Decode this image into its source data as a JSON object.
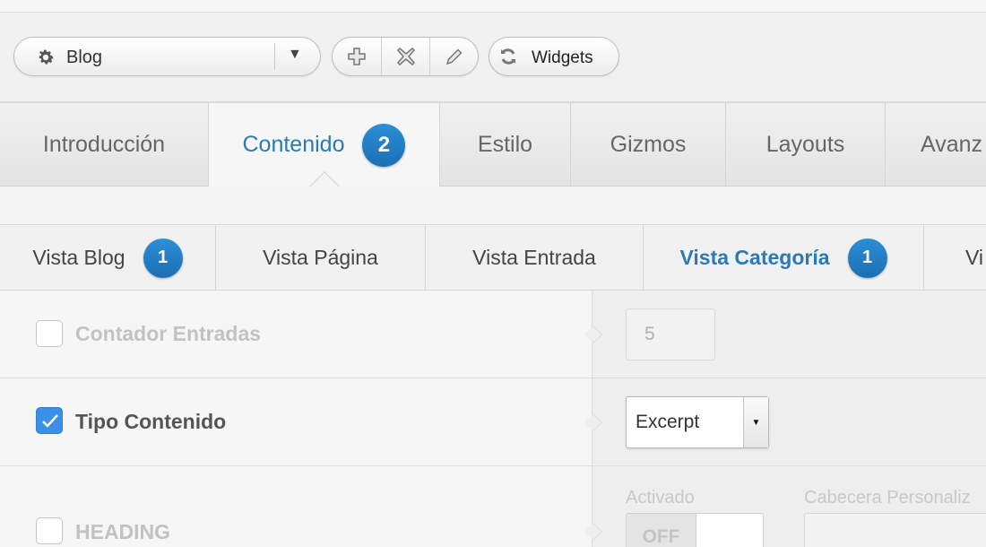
{
  "toolbar": {
    "layout_select": {
      "value": "Blog",
      "icon": "gear-icon"
    },
    "actions": [
      {
        "name": "add",
        "icon": "plus-icon"
      },
      {
        "name": "remove",
        "icon": "x-icon"
      },
      {
        "name": "edit",
        "icon": "pencil-icon"
      }
    ],
    "widgets_label": "Widgets",
    "widgets_icon": "refresh-icon"
  },
  "main_tabs": [
    {
      "label": "Introducción",
      "badge": null,
      "active": false
    },
    {
      "label": "Contenido",
      "badge": "2",
      "active": true
    },
    {
      "label": "Estilo",
      "badge": null,
      "active": false
    },
    {
      "label": "Gizmos",
      "badge": null,
      "active": false
    },
    {
      "label": "Layouts",
      "badge": null,
      "active": false
    },
    {
      "label": "Avanz",
      "badge": null,
      "active": false
    }
  ],
  "sub_tabs": [
    {
      "label": "Vista Blog",
      "badge": "1",
      "active": false
    },
    {
      "label": "Vista Página",
      "badge": null,
      "active": false
    },
    {
      "label": "Vista Entrada",
      "badge": null,
      "active": false
    },
    {
      "label": "Vista Categoría",
      "badge": "1",
      "active": true
    },
    {
      "label": "Vi",
      "badge": null,
      "active": false
    }
  ],
  "options": {
    "contador": {
      "label": "Contador Entradas",
      "checked": false,
      "value": "5"
    },
    "tipo": {
      "label": "Tipo Contenido",
      "checked": true,
      "value": "Excerpt"
    },
    "heading": {
      "label": "HEADING",
      "checked": false,
      "activado_label": "Activado",
      "toggle_value": "OFF",
      "cabecera_label": "Cabecera Personaliz"
    }
  },
  "colors": {
    "accent": "#2a7ab8",
    "badge": "#1f7cc4",
    "checkbox_checked": "#3b8fe6"
  }
}
